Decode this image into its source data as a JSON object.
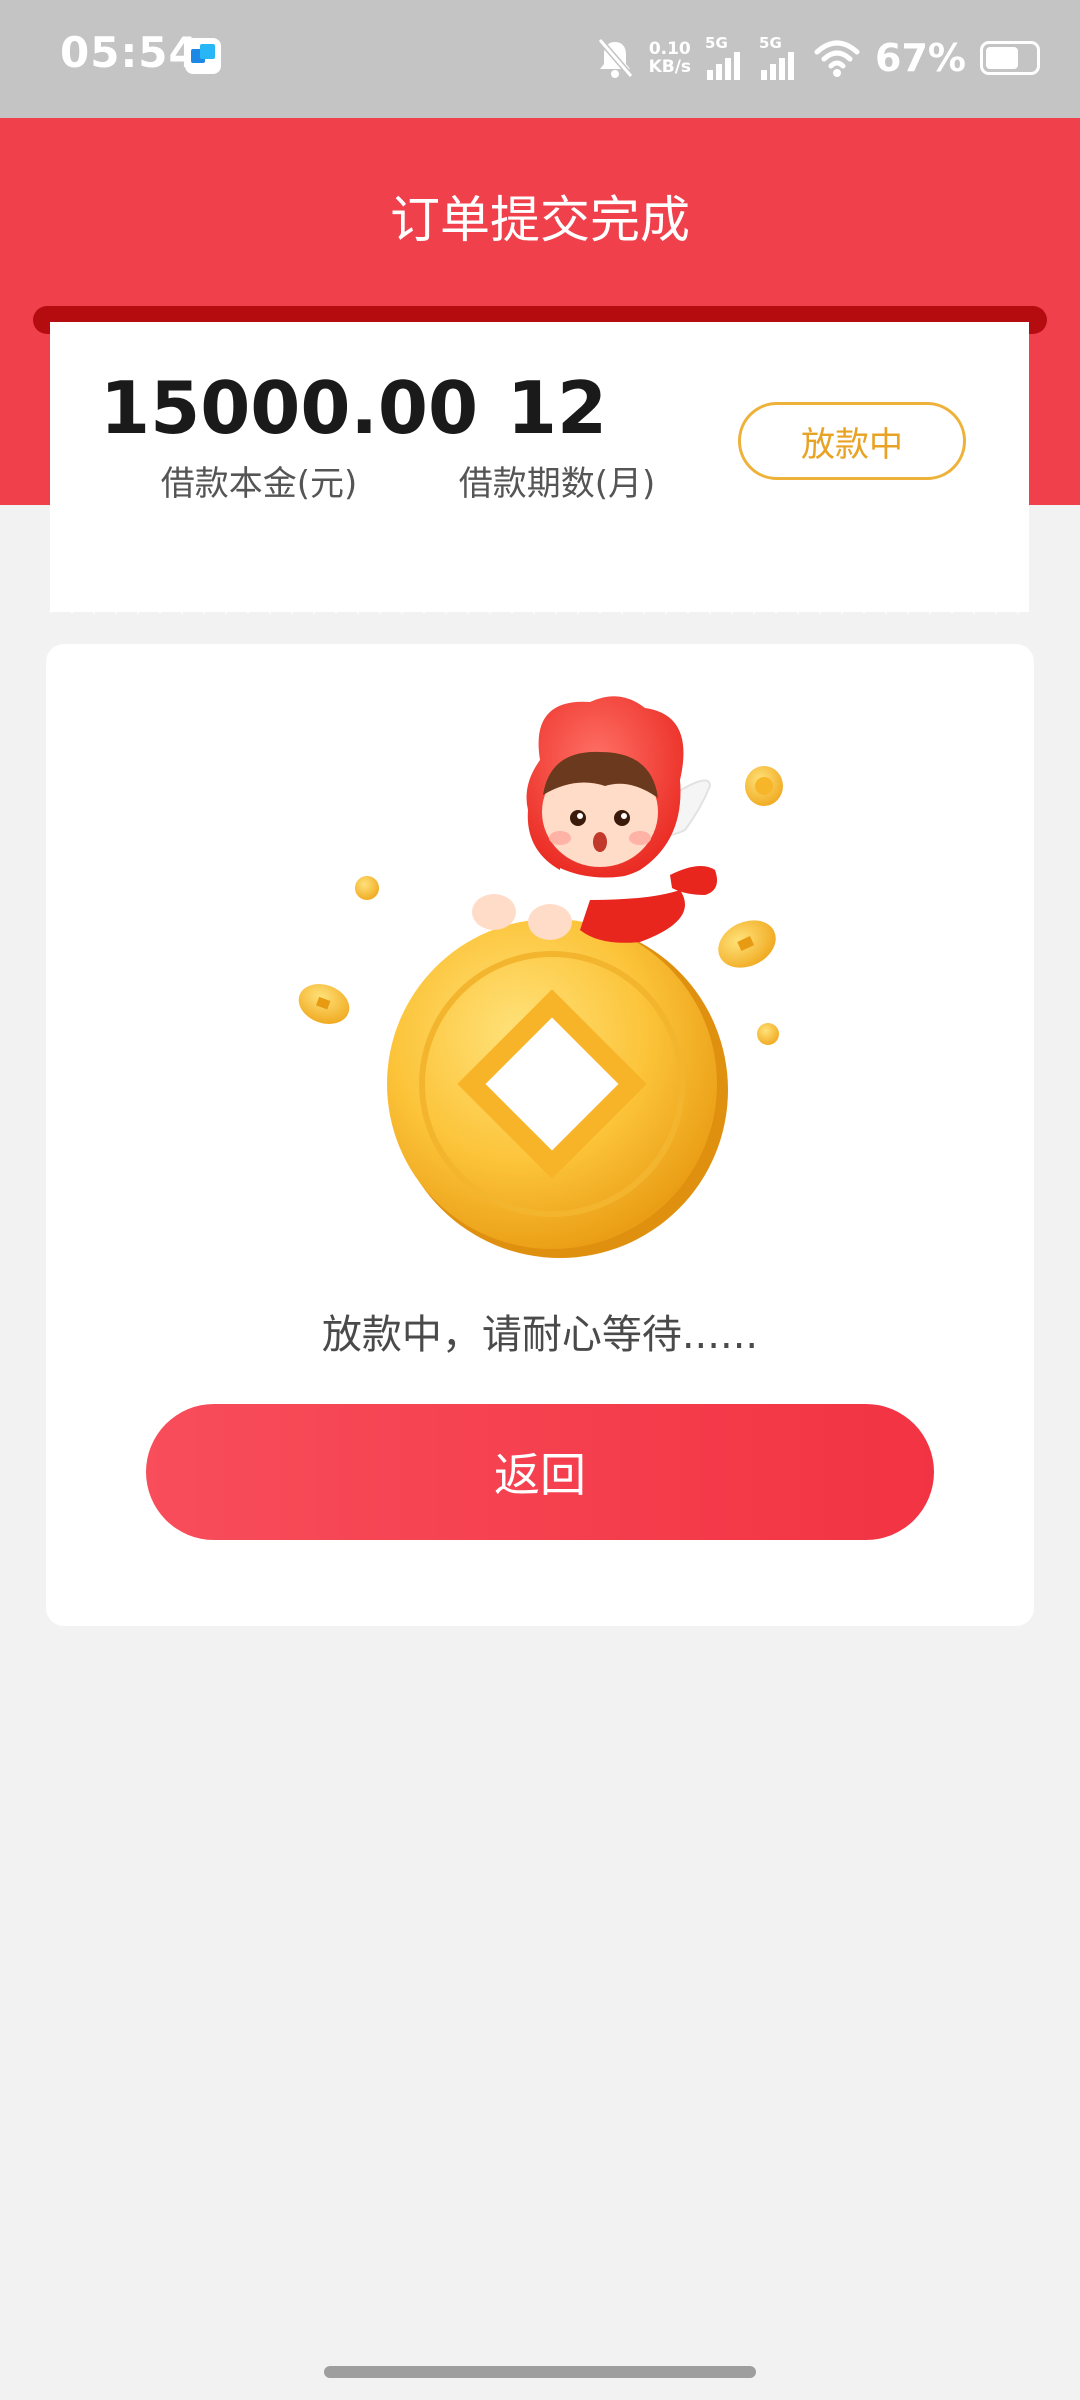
{
  "status_bar": {
    "time": "05:54",
    "net_speed_value": "0.10",
    "net_speed_unit": "KB/s",
    "signal_1_label": "5G",
    "signal_2_label": "5G",
    "battery_percent": "67%",
    "battery_level": 0.67,
    "icons": [
      "app-notification-icon",
      "mute-bell-icon",
      "signal-icon",
      "wifi-icon",
      "battery-icon"
    ]
  },
  "header": {
    "title": "订单提交完成",
    "color": "#f0404c"
  },
  "receipt": {
    "principal_value": "15000.00",
    "principal_label": "借款本金(元)",
    "term_value": "12",
    "term_label": "借款期数(月)",
    "status_badge": "放款中",
    "badge_color": "#eeb13a"
  },
  "main": {
    "waiting_text": "放款中，请耐心等待......",
    "back_button_label": "返回",
    "button_color": "#f23343"
  }
}
